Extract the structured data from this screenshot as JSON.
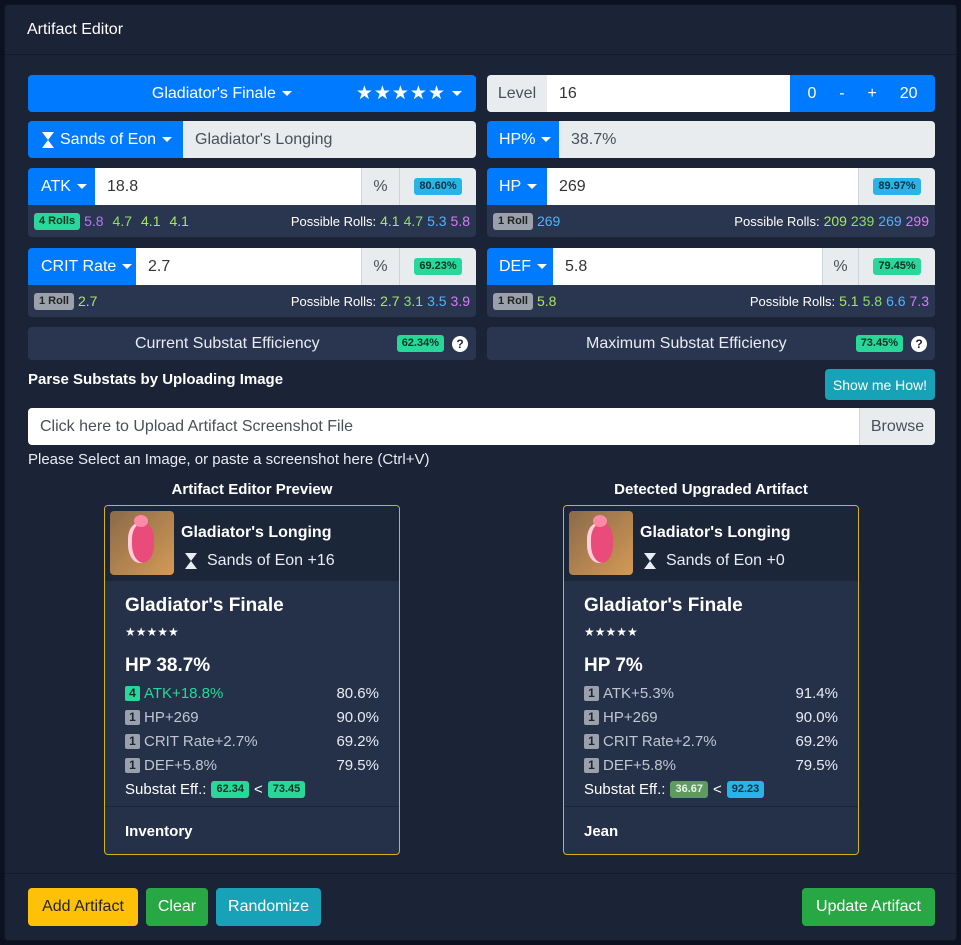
{
  "header": {
    "title": "Artifact Editor"
  },
  "set": {
    "name": "Gladiator's Finale",
    "stars": "★★★★★"
  },
  "level": {
    "label": "Level",
    "value": "16",
    "btn_min": "0",
    "btn_minus": "-",
    "btn_plus": "+",
    "btn_max": "20"
  },
  "slot": {
    "label": "Sands of Eon",
    "piece_name": "Gladiator's Longing"
  },
  "main_stat": {
    "label": "HP%",
    "value": "38.7%"
  },
  "substats": [
    {
      "label": "ATK",
      "value": "18.8",
      "unit": "%",
      "eff": "80.60%",
      "rolls_badge": "4 Rolls",
      "rolls": [
        "5.8",
        "4.7",
        "4.1",
        "4.1"
      ],
      "possible_label": "Possible Rolls:",
      "possible": [
        "4.1",
        "4.7",
        "5.3",
        "5.8"
      ]
    },
    {
      "label": "HP",
      "value": "269",
      "unit": "",
      "eff": "89.97%",
      "rolls_badge": "1 Roll",
      "rolls": [
        "269"
      ],
      "possible_label": "Possible Rolls:",
      "possible": [
        "209",
        "239",
        "269",
        "299"
      ]
    },
    {
      "label": "CRIT Rate",
      "value": "2.7",
      "unit": "%",
      "eff": "69.23%",
      "rolls_badge": "1 Roll",
      "rolls": [
        "2.7"
      ],
      "possible_label": "Possible Rolls:",
      "possible": [
        "2.7",
        "3.1",
        "3.5",
        "3.9"
      ]
    },
    {
      "label": "DEF",
      "value": "5.8",
      "unit": "%",
      "eff": "79.45%",
      "rolls_badge": "1 Roll",
      "rolls": [
        "5.8"
      ],
      "possible_label": "Possible Rolls:",
      "possible": [
        "5.1",
        "5.8",
        "6.6",
        "7.3"
      ]
    }
  ],
  "efficiency": {
    "current_label": "Current Substat Efficiency",
    "current_value": "62.34%",
    "max_label": "Maximum Substat Efficiency",
    "max_value": "73.45%",
    "help": "?"
  },
  "upload": {
    "title": "Parse Substats by Uploading Image",
    "show_me": "Show me How!",
    "placeholder": "Click here to Upload Artifact Screenshot File",
    "browse": "Browse",
    "hint": "Please Select an Image, or paste a screenshot here (Ctrl+V)"
  },
  "previews": [
    {
      "heading": "Artifact Editor Preview",
      "piece_name": "Gladiator's Longing",
      "slot_level": "Sands of Eon +16",
      "set_name": "Gladiator's Finale",
      "stars": "★★★★★",
      "main": "HP 38.7%",
      "subs": [
        {
          "n": "4",
          "text": "ATK+18.8%",
          "pct": "80.6%",
          "highlight": true
        },
        {
          "n": "1",
          "text": "HP+269",
          "pct": "90.0%",
          "highlight": false
        },
        {
          "n": "1",
          "text": "CRIT Rate+2.7%",
          "pct": "69.2%",
          "highlight": false
        },
        {
          "n": "1",
          "text": "DEF+5.8%",
          "pct": "79.5%",
          "highlight": false
        }
      ],
      "eff_label": "Substat Eff.:",
      "eff_cur": "62.34",
      "lt": "<",
      "eff_max": "73.45",
      "location": "Inventory"
    },
    {
      "heading": "Detected Upgraded Artifact",
      "piece_name": "Gladiator's Longing",
      "slot_level": "Sands of Eon +0",
      "set_name": "Gladiator's Finale",
      "stars": "★★★★★",
      "main": "HP 7%",
      "subs": [
        {
          "n": "1",
          "text": "ATK+5.3%",
          "pct": "91.4%",
          "highlight": false
        },
        {
          "n": "1",
          "text": "HP+269",
          "pct": "90.0%",
          "highlight": false
        },
        {
          "n": "1",
          "text": "CRIT Rate+2.7%",
          "pct": "69.2%",
          "highlight": false
        },
        {
          "n": "1",
          "text": "DEF+5.8%",
          "pct": "79.5%",
          "highlight": false
        }
      ],
      "eff_label": "Substat Eff.:",
      "eff_cur": "36.67",
      "lt": "<",
      "eff_max": "92.23",
      "location": "Jean"
    }
  ],
  "footer": {
    "add": "Add Artifact",
    "clear": "Clear",
    "randomize": "Randomize",
    "update": "Update Artifact"
  },
  "colors": {
    "primary": "#007bff",
    "success": "#28a745",
    "warning": "#ffc107",
    "info": "#17a2b8",
    "gold_border": "#d4b418"
  }
}
